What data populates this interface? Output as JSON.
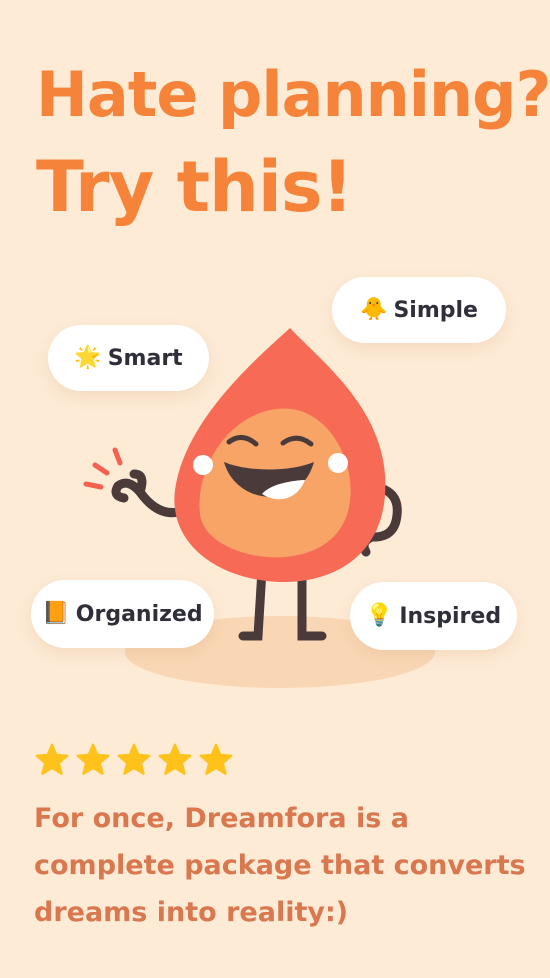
{
  "headline": {
    "line1": "Hate planning?",
    "line2": "Try this!"
  },
  "badges": [
    {
      "emoji": "🐥",
      "label": "Simple"
    },
    {
      "emoji": "🌟",
      "label": "Smart"
    },
    {
      "emoji": "📙",
      "label": "Organized"
    },
    {
      "emoji": "💡",
      "label": "Inspired"
    }
  ],
  "rating": {
    "stars": 5,
    "max": 5
  },
  "review": {
    "text": "For once, Dreamfora is a complete package that converts dreams into reality:)"
  },
  "colors": {
    "background": "#fdebd6",
    "headline": "#f5843a",
    "review_text": "#d9774f",
    "star": "#ffc21a",
    "mascot_body": "#f66a56",
    "mascot_face": "#f7a466",
    "mascot_limbs": "#4a3b3a"
  }
}
